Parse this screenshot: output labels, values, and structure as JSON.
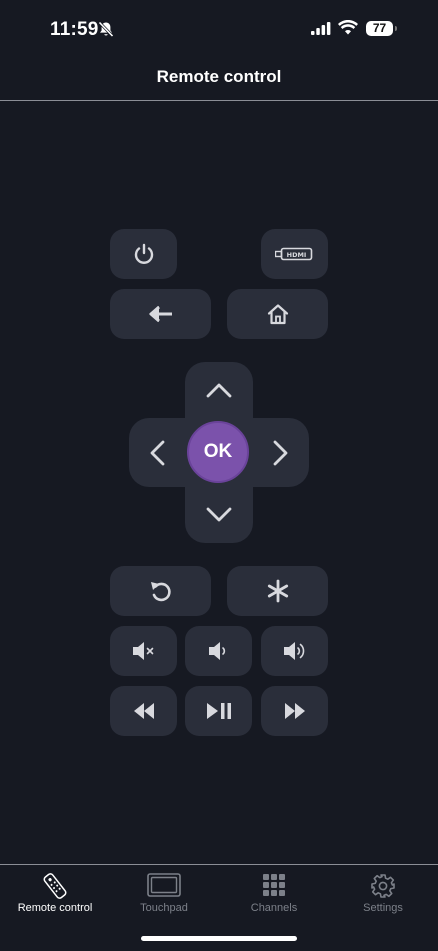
{
  "status_bar": {
    "time": "11:59",
    "battery": "77"
  },
  "header": {
    "title": "Remote control"
  },
  "remote": {
    "ok_label": "OK"
  },
  "tabs": [
    {
      "label": "Remote control",
      "icon": "remote-icon",
      "active": true
    },
    {
      "label": "Touchpad",
      "icon": "touchpad-icon",
      "active": false
    },
    {
      "label": "Channels",
      "icon": "grid-icon",
      "active": false
    },
    {
      "label": "Settings",
      "icon": "gear-icon",
      "active": false
    }
  ],
  "colors": {
    "background": "#161922",
    "button": "#2a2e3a",
    "accent": "#7b52ab",
    "icon": "#d8d9de"
  }
}
